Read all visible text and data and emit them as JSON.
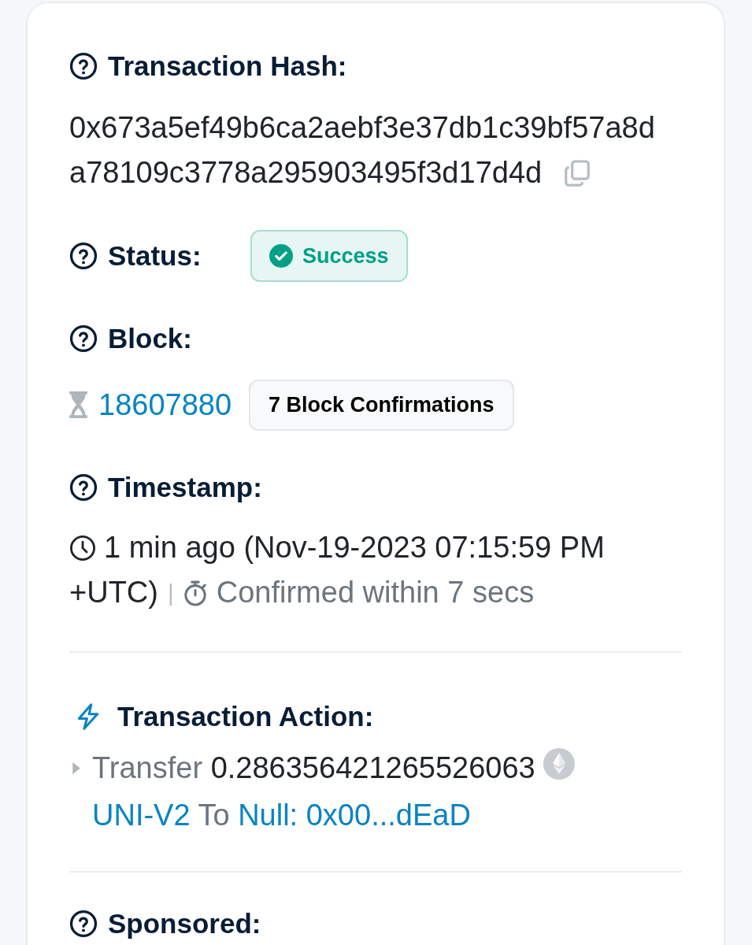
{
  "transaction_hash": {
    "label": "Transaction Hash:",
    "value": "0x673a5ef49b6ca2aebf3e37db1c39bf57a8da78109c3778a295903495f3d17d4d"
  },
  "status": {
    "label": "Status:",
    "badge": {
      "text": "Success",
      "kind": "success"
    }
  },
  "block": {
    "label": "Block:",
    "number": "18607880",
    "confirmations": "7 Block Confirmations"
  },
  "timestamp": {
    "label": "Timestamp:",
    "age": "1 min ago (Nov-19-2023 07:15:59 PM +UTC)",
    "separator": "|",
    "confirmed": "Confirmed within 7 secs"
  },
  "transaction_action": {
    "label": "Transaction Action:",
    "actions": [
      {
        "verb": "Transfer",
        "amount": "0.286356421265526063",
        "token": "UNI-V2",
        "preposition": "To",
        "recipient": "Null: 0x00...dEaD"
      }
    ]
  },
  "sponsored": {
    "label": "Sponsored:"
  }
}
